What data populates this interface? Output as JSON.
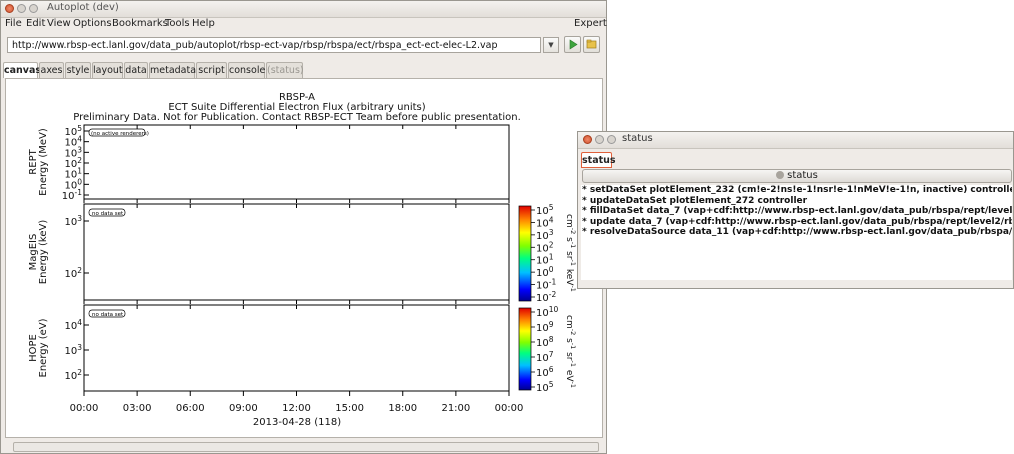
{
  "main_window": {
    "title": "Autoplot (dev)",
    "menu": [
      "File",
      "Edit",
      "View",
      "Options",
      "Bookmarks",
      "Tools",
      "Help"
    ],
    "expert_label": "Expert",
    "url": "http://www.rbsp-ect.lanl.gov/data_pub/autoplot/rbsp-ect-vap/rbsp/rbspa/ect/rbspa_ect-ect-elec-L2.vap",
    "tabs": [
      "canvas",
      "axes",
      "style",
      "layout",
      "data",
      "metadata",
      "script",
      "console",
      "(status)"
    ],
    "active_tab": "canvas"
  },
  "plot": {
    "title_lines": [
      "RBSP-A",
      "ECT Suite Differential Electron Flux (arbitrary units)",
      "Preliminary Data. Not for Publication. Contact RBSP-ECT Team before public presentation."
    ],
    "panels": [
      {
        "ylabel_line1": "REPT",
        "ylabel_line2": "Energy (MeV)",
        "message": "(no active renderers)",
        "ticks": [
          "10^5",
          "10^4",
          "10^3",
          "10^2",
          "10^1",
          "10^0",
          "10^-1"
        ]
      },
      {
        "ylabel_line1": "MagEIS",
        "ylabel_line2": "Energy (keV)",
        "message": "no data set",
        "ticks": [
          "10^3",
          "10^2"
        ],
        "colorbar_label": "cm^-2 s^-1 sr^-1 keV^-1",
        "colorbar_ticks": [
          "10^5",
          "10^4",
          "10^3",
          "10^2",
          "10^1",
          "10^0",
          "10^-1",
          "10^-2"
        ]
      },
      {
        "ylabel_line1": "HOPE",
        "ylabel_line2": "Energy (eV)",
        "message": "no data set",
        "ticks": [
          "10^4",
          "10^3",
          "10^2"
        ],
        "colorbar_label": "cm^-2 s^-1 sr^-1 eV^-1",
        "colorbar_ticks": [
          "10^10",
          "10^9",
          "10^8",
          "10^7",
          "10^6",
          "10^5"
        ]
      }
    ],
    "x_ticks": [
      "00:00",
      "03:00",
      "06:00",
      "09:00",
      "12:00",
      "15:00",
      "18:00",
      "21:00",
      "00:00"
    ],
    "x_label": "2013-04-28 (118)"
  },
  "status_window": {
    "title": "status",
    "tab": "status",
    "button_label": "status",
    "lines": [
      "* setDataSet plotElement_232 (cm!e-2!ns!e-1!nsr!e-1!nMeV!e-1!n, inactive) controller",
      "* updateDataSet plotElement_272 controller",
      "* fillDataSet data_7 (vap+cdf:http://www.rbsp-ect.lanl.gov/data_pub/rbspa/rept/level2/rbspa_pre_",
      "* update data_7 (vap+cdf:http://www.rbsp-ect.lanl.gov/data_pub/rbspa/rept/level2/rbspa_pre_ect",
      "* resolveDataSource data_11 (vap+cdf:http://www.rbsp-ect.lanl.gov/data_pub/rbspa/hope/level2/r"
    ]
  },
  "colors": {
    "window_bg": "#efebe7",
    "close_button": "#e0603a",
    "go_button": "#3ea53e"
  }
}
